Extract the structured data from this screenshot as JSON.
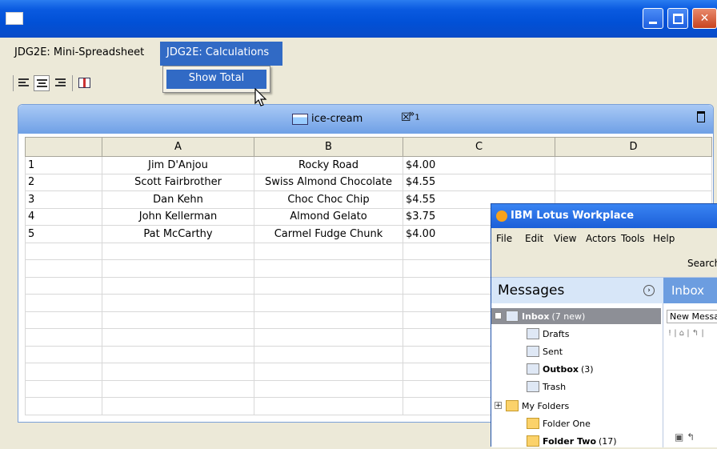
{
  "window": {
    "buttons": {
      "minimize": "minimize",
      "maximize": "maximize",
      "close": "close"
    }
  },
  "menubar": {
    "items": [
      "JDG2E: Mini-Spreadsheet",
      "JDG2E: Calculations"
    ],
    "selected_index": 1
  },
  "dropdown": {
    "items": [
      "Show Total"
    ]
  },
  "toolbar": {
    "icons": [
      "align-left-icon",
      "align-center-icon",
      "align-right-icon",
      "chart-icon"
    ],
    "active": "align-center-icon"
  },
  "sheet": {
    "tab_label": "ice-cream",
    "overflow_count": "1",
    "columns": [
      "",
      "A",
      "B",
      "C",
      "D"
    ],
    "rows": [
      {
        "n": "1",
        "a": "Jim D'Anjou",
        "b": "Rocky Road",
        "c": "$4.00",
        "d": ""
      },
      {
        "n": "2",
        "a": "Scott Fairbrother",
        "b": "Swiss Almond Chocolate",
        "c": "$4.55",
        "d": ""
      },
      {
        "n": "3",
        "a": "Dan Kehn",
        "b": "Choc Choc Chip",
        "c": "$4.55",
        "d": ""
      },
      {
        "n": "4",
        "a": "John Kellerman",
        "b": "Almond Gelato",
        "c": "$3.75",
        "d": ""
      },
      {
        "n": "5",
        "a": "Pat McCarthy",
        "b": "Carmel Fudge Chunk",
        "c": "$4.00",
        "d": ""
      }
    ],
    "empty_rows": 10
  },
  "lotus": {
    "title": "IBM Lotus Workplace",
    "menu": [
      "File",
      "Edit",
      "View",
      "Actors",
      "Tools",
      "Help"
    ],
    "search_label": "Search",
    "messages_title": "Messages",
    "tree": [
      {
        "label": "Inbox",
        "extra": "(7 new)",
        "bold": true
      },
      {
        "label": "Drafts",
        "extra": "",
        "bold": false
      },
      {
        "label": "Sent",
        "extra": "",
        "bold": false
      },
      {
        "label": "Outbox",
        "extra": "(3)",
        "bold": true
      },
      {
        "label": "Trash",
        "extra": "",
        "bold": false
      },
      {
        "label": "My Folders",
        "extra": "",
        "bold": false
      },
      {
        "label": "Folder One",
        "extra": "",
        "bold": false
      },
      {
        "label": "Folder Two",
        "extra": "(17)",
        "bold": true
      }
    ],
    "inbox_title": "Inbox",
    "new_message_label": "New Message"
  }
}
